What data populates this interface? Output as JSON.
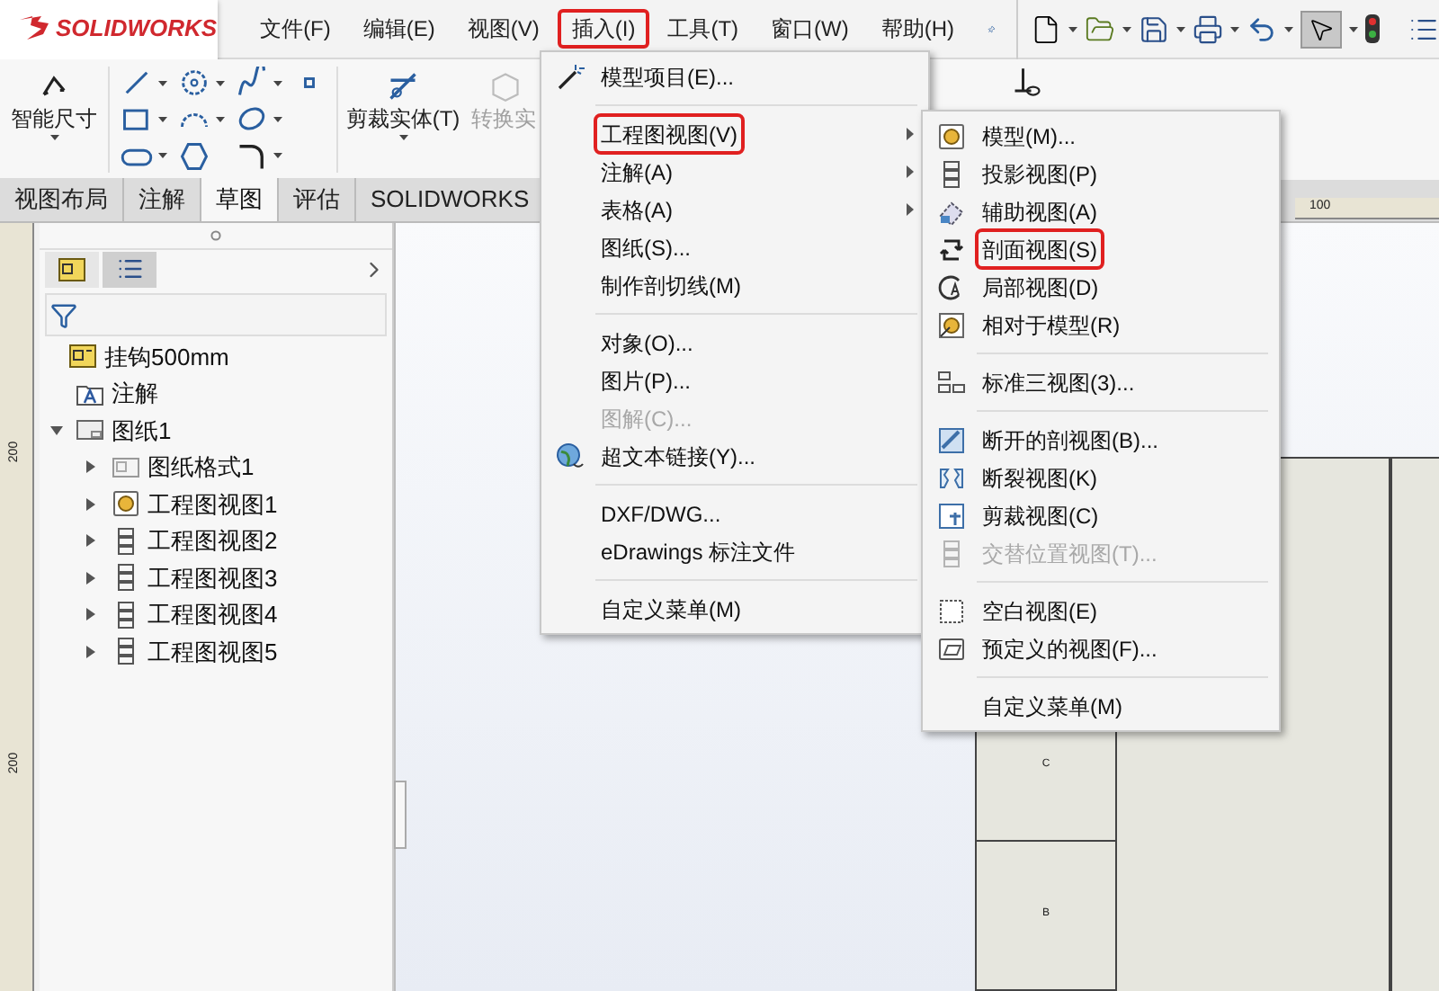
{
  "app": {
    "logo": "SOLIDWORKS"
  },
  "menu_bar": [
    {
      "label": "文件(F)",
      "selected": false
    },
    {
      "label": "编辑(E)",
      "selected": false
    },
    {
      "label": "视图(V)",
      "selected": false
    },
    {
      "label": "插入(I)",
      "selected": true
    },
    {
      "label": "工具(T)",
      "selected": false
    },
    {
      "label": "窗口(W)",
      "selected": false
    },
    {
      "label": "帮助(H)",
      "selected": false
    }
  ],
  "command_manager": {
    "tools": [
      {
        "label": "智能尺寸",
        "disabled": false
      },
      {
        "label": "剪裁实体(T)",
        "disabled": false
      },
      {
        "label": "转换实",
        "disabled": true
      }
    ]
  },
  "tabs": [
    {
      "label": "视图布局",
      "selected": false
    },
    {
      "label": "注解",
      "selected": false
    },
    {
      "label": "草图",
      "selected": true
    },
    {
      "label": "评估",
      "selected": false
    },
    {
      "label": "SOLIDWORKS",
      "selected": false
    }
  ],
  "rulers": {
    "left_labels": [
      "200",
      "200"
    ],
    "top_label": "100"
  },
  "sheet": {
    "zone_labels": [
      "C",
      "B"
    ]
  },
  "feature_tree": {
    "items": [
      {
        "label": "挂钩500mm",
        "children": [
          {
            "label": "注解"
          },
          {
            "label": "图纸1",
            "expanded": true,
            "children": [
              {
                "label": "图纸格式1",
                "expanded": false
              },
              {
                "label": "工程图视图1",
                "expanded": false
              },
              {
                "label": "工程图视图2",
                "expanded": false
              },
              {
                "label": "工程图视图3",
                "expanded": false
              },
              {
                "label": "工程图视图4",
                "expanded": false
              },
              {
                "label": "工程图视图5",
                "expanded": false
              }
            ]
          }
        ]
      }
    ]
  },
  "insert_menu": {
    "items": [
      {
        "kind": "item",
        "label": "模型项目(E)...",
        "submenu": false,
        "disabled": false,
        "selected": false
      },
      {
        "kind": "separator"
      },
      {
        "kind": "item",
        "label": "工程图视图(V)",
        "submenu": true,
        "disabled": false,
        "selected": true
      },
      {
        "kind": "item",
        "label": "注解(A)",
        "submenu": true,
        "disabled": false,
        "selected": false
      },
      {
        "kind": "item",
        "label": "表格(A)",
        "submenu": true,
        "disabled": false,
        "selected": false
      },
      {
        "kind": "item",
        "label": "图纸(S)...",
        "submenu": false,
        "disabled": false,
        "selected": false
      },
      {
        "kind": "item",
        "label": "制作剖切线(M)",
        "submenu": false,
        "disabled": false,
        "selected": false
      },
      {
        "kind": "separator"
      },
      {
        "kind": "item",
        "label": "对象(O)...",
        "submenu": false,
        "disabled": false,
        "selected": false
      },
      {
        "kind": "item",
        "label": "图片(P)...",
        "submenu": false,
        "disabled": false,
        "selected": false
      },
      {
        "kind": "item",
        "label": "图解(C)...",
        "submenu": false,
        "disabled": true,
        "selected": false
      },
      {
        "kind": "item",
        "label": "超文本链接(Y)...",
        "submenu": false,
        "disabled": false,
        "selected": false
      },
      {
        "kind": "separator"
      },
      {
        "kind": "item",
        "label": "DXF/DWG...",
        "submenu": false,
        "disabled": false,
        "selected": false
      },
      {
        "kind": "item",
        "label": "eDrawings 标注文件",
        "submenu": false,
        "disabled": false,
        "selected": false
      },
      {
        "kind": "separator"
      },
      {
        "kind": "item",
        "label": "自定义菜单(M)",
        "submenu": false,
        "disabled": false,
        "selected": false
      }
    ]
  },
  "drawing_view_submenu": {
    "items": [
      {
        "kind": "item",
        "label": "模型(M)...",
        "disabled": false,
        "selected": false
      },
      {
        "kind": "item",
        "label": "投影视图(P)",
        "disabled": false,
        "selected": false
      },
      {
        "kind": "item",
        "label": "辅助视图(A)",
        "disabled": false,
        "selected": false
      },
      {
        "kind": "item",
        "label": "剖面视图(S)",
        "disabled": false,
        "selected": true
      },
      {
        "kind": "item",
        "label": "局部视图(D)",
        "disabled": false,
        "selected": false
      },
      {
        "kind": "item",
        "label": "相对于模型(R)",
        "disabled": false,
        "selected": false
      },
      {
        "kind": "separator"
      },
      {
        "kind": "item",
        "label": "标准三视图(3)...",
        "disabled": false,
        "selected": false
      },
      {
        "kind": "separator"
      },
      {
        "kind": "item",
        "label": "断开的剖视图(B)...",
        "disabled": false,
        "selected": false
      },
      {
        "kind": "item",
        "label": "断裂视图(K)",
        "disabled": false,
        "selected": false
      },
      {
        "kind": "item",
        "label": "剪裁视图(C)",
        "disabled": false,
        "selected": false
      },
      {
        "kind": "item",
        "label": "交替位置视图(T)...",
        "disabled": true,
        "selected": false
      },
      {
        "kind": "separator"
      },
      {
        "kind": "item",
        "label": "空白视图(E)",
        "disabled": false,
        "selected": false
      },
      {
        "kind": "item",
        "label": "预定义的视图(F)...",
        "disabled": false,
        "selected": false
      },
      {
        "kind": "separator"
      },
      {
        "kind": "item",
        "label": "自定义菜单(M)",
        "disabled": false,
        "selected": false
      }
    ]
  }
}
